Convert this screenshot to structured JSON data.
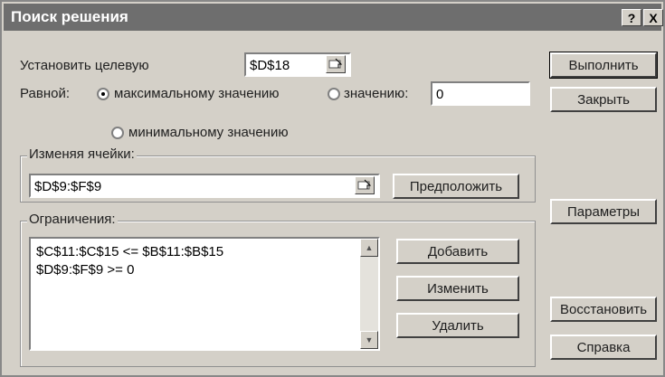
{
  "window": {
    "title": "Поиск решения",
    "help_label": "?",
    "close_label": "X"
  },
  "target": {
    "label": "Установить целевую",
    "cell": "$D$18"
  },
  "equal": {
    "label": "Равной:",
    "options": [
      {
        "label": "максимальному значению",
        "selected": true
      },
      {
        "label": "значению:",
        "selected": false,
        "value": "0"
      },
      {
        "label": "минимальному значению",
        "selected": false
      }
    ]
  },
  "changing": {
    "label": "Изменяя ячейки:",
    "value": "$D$9:$F$9",
    "guess_label": "Предположить"
  },
  "constraints": {
    "label": "Ограничения:",
    "items": [
      "$C$11:$C$15 <= $B$11:$B$15",
      "$D$9:$F$9 >= 0"
    ],
    "add_label": "Добавить",
    "change_label": "Изменить",
    "delete_label": "Удалить"
  },
  "side_buttons": {
    "solve": "Выполнить",
    "close": "Закрыть",
    "options": "Параметры",
    "reset": "Восстановить",
    "help": "Справка"
  }
}
